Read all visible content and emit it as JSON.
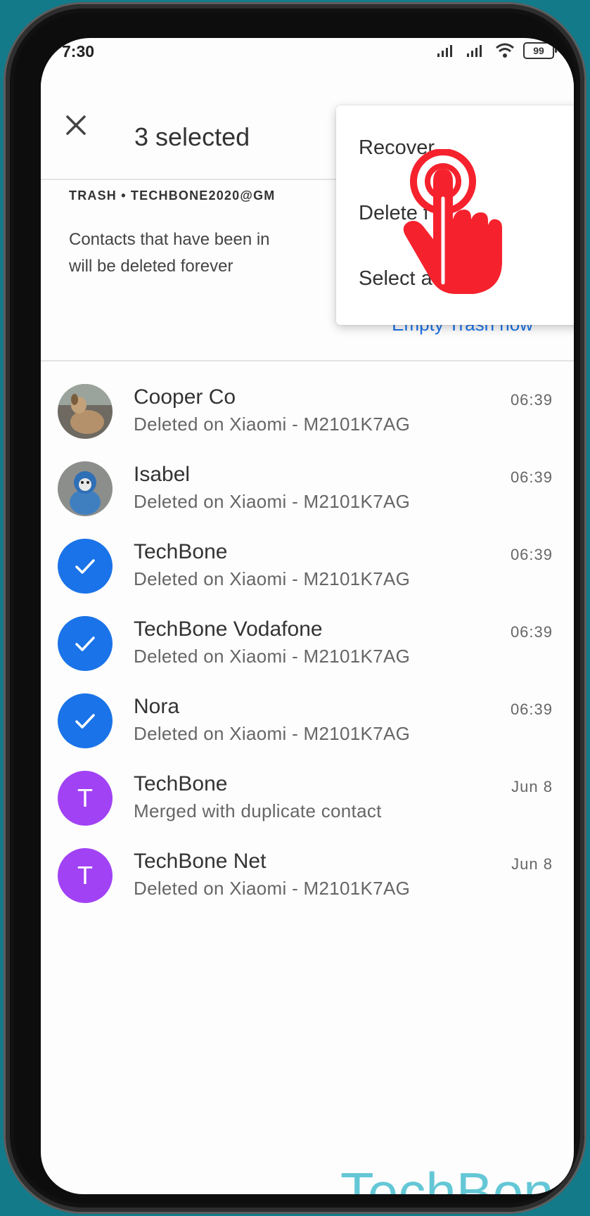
{
  "status_bar": {
    "time": "7:30",
    "battery": "99"
  },
  "header": {
    "title": "3 selected"
  },
  "trash": {
    "header": "TRASH • TECHBONE2020@GM",
    "description": "Contacts that have been in will be deleted forever",
    "empty_link": "Empty Trash now"
  },
  "menu": {
    "items": [
      "Recover",
      "Delete f",
      "Select a"
    ]
  },
  "contacts": [
    {
      "name": "Cooper Co",
      "sub": "Deleted on Xiaomi - M2101K7AG",
      "time": "06:39",
      "avatar": "photo-dog",
      "selected": false
    },
    {
      "name": "Isabel",
      "sub": "Deleted on Xiaomi - M2101K7AG",
      "time": "06:39",
      "avatar": "photo-plush",
      "selected": false
    },
    {
      "name": "TechBone",
      "sub": "Deleted on Xiaomi - M2101K7AG",
      "time": "06:39",
      "avatar": "check-icon",
      "selected": true
    },
    {
      "name": "TechBone Vodafone",
      "sub": "Deleted on Xiaomi - M2101K7AG",
      "time": "06:39",
      "avatar": "check-icon",
      "selected": true
    },
    {
      "name": "Nora",
      "sub": "Deleted on Xiaomi - M2101K7AG",
      "time": "06:39",
      "avatar": "check-icon",
      "selected": true
    },
    {
      "name": "TechBone",
      "sub": "Merged with duplicate contact",
      "time": "Jun 8",
      "avatar": "letter",
      "letter": "T",
      "selected": false
    },
    {
      "name": "TechBone Net",
      "sub": "Deleted on Xiaomi - M2101K7AG",
      "time": "Jun 8",
      "avatar": "letter",
      "letter": "T",
      "selected": false
    }
  ],
  "watermark": "TechBone",
  "colors": {
    "accent": "#1a73e8",
    "letter_avatar": "#a142f4",
    "tap_indicator": "#f5222d",
    "watermark": "#64c7d6"
  }
}
